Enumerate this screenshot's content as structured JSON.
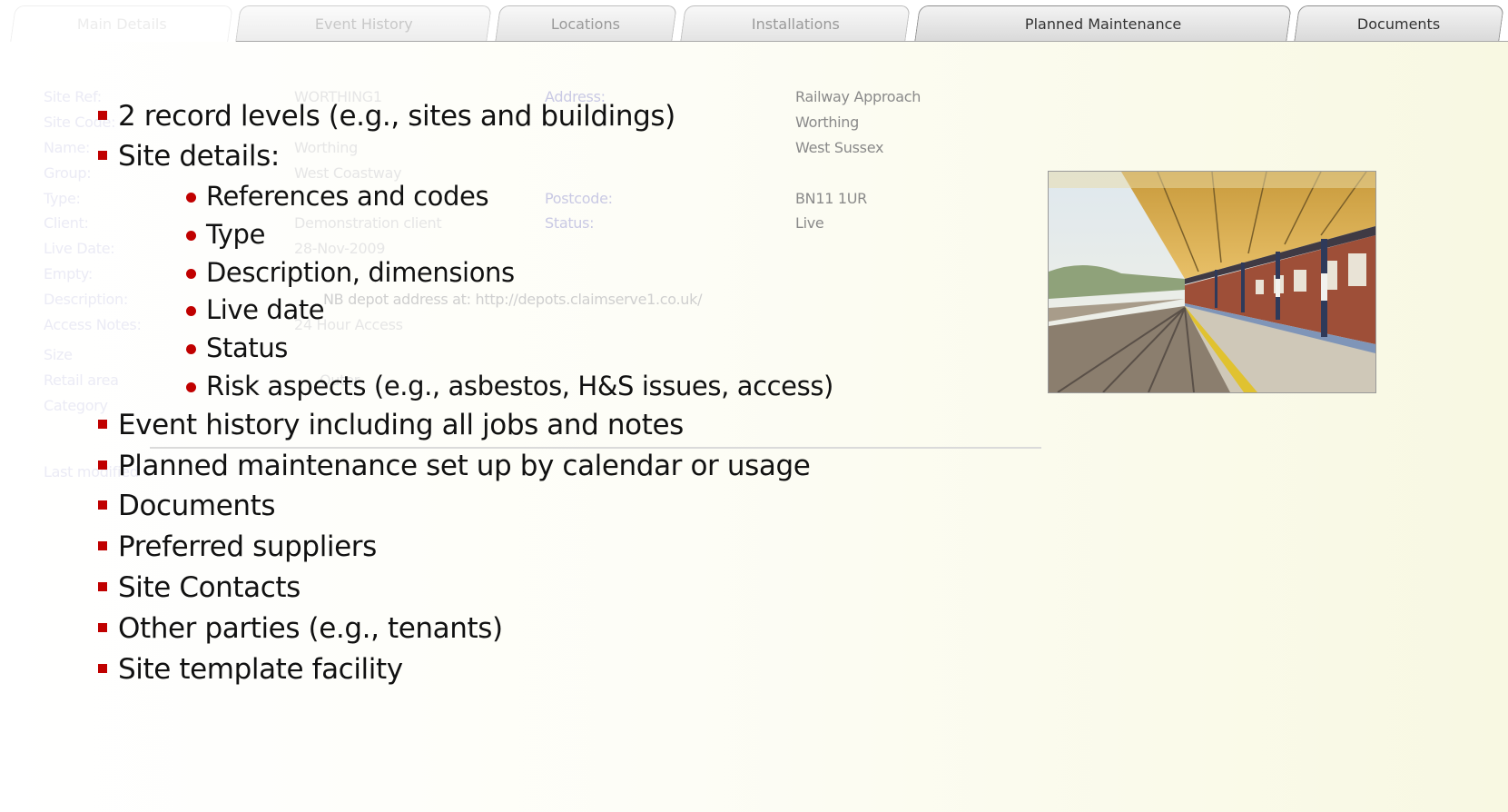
{
  "tabs": [
    {
      "label": "Main Details"
    },
    {
      "label": "Event History"
    },
    {
      "label": "Locations"
    },
    {
      "label": "Installations"
    },
    {
      "label": "Planned Maintenance"
    },
    {
      "label": "Documents"
    }
  ],
  "form": {
    "labels_left": [
      "Site Ref:",
      "Site Code:",
      "Name:",
      "Group:",
      "Type:",
      "Client:",
      "Live Date:",
      "Empty:",
      "Description:",
      "Access Notes:",
      "Size",
      "Retail area",
      "Category"
    ],
    "values_left": [
      "WORTHING1",
      "Worthing",
      "West Coastway",
      "Demonstration client",
      "28-Nov-2009",
      "NB depot address at: http://depots.claimserve1.co.uk/",
      "24 Hour Access",
      "Outer"
    ],
    "address_label": "Address:",
    "address_lines": [
      "Railway Approach",
      "Worthing",
      "West Sussex"
    ],
    "postcode_label": "Postcode:",
    "postcode_value": "BN11 1UR",
    "status_label": "Status:",
    "status_value": "Live",
    "modified_text": "Last modified"
  },
  "photo": {
    "icon": "railway-station-photo"
  },
  "bullets": {
    "l1": "2 record levels (e.g., sites and buildings)",
    "l2": "Site details:",
    "sub": [
      "References and codes",
      "Type",
      "Description, dimensions",
      "Live date",
      "Status",
      "Risk aspects (e.g., asbestos, H&S issues, access)"
    ],
    "rest": [
      "Event history including all jobs and notes",
      "Planned maintenance set up by calendar or usage",
      "Documents",
      "Preferred suppliers",
      "Site Contacts",
      "Other parties (e.g., tenants)",
      "Site template facility"
    ]
  },
  "colors": {
    "bullet": "#c00000",
    "accent_bg": "#f8f8e2"
  }
}
